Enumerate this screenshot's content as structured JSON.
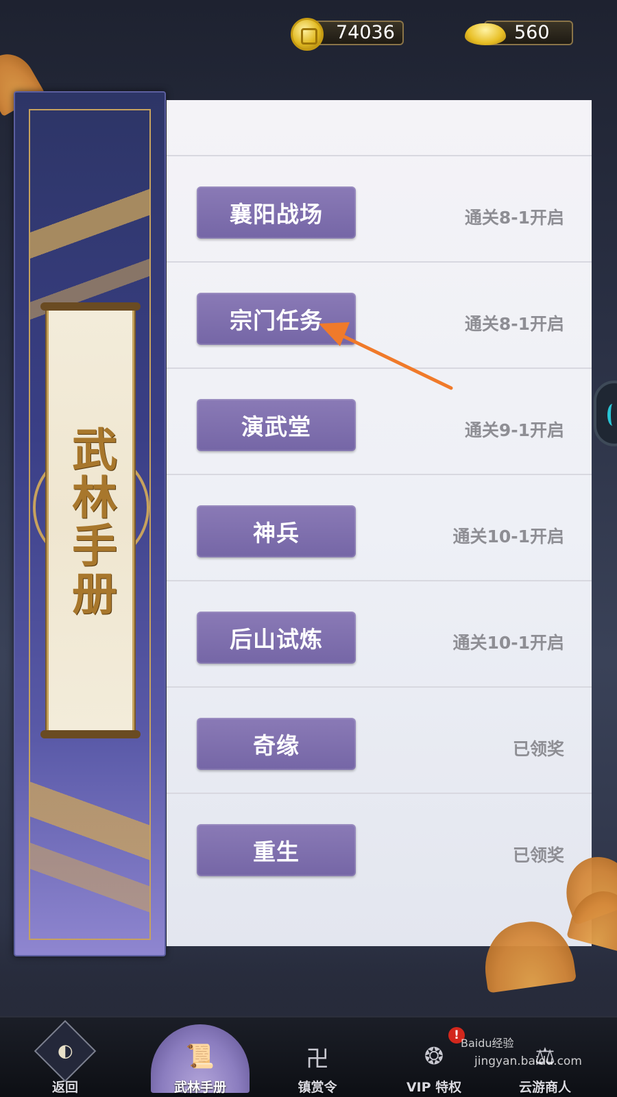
{
  "currency": {
    "coins": "74036",
    "ingots": "560"
  },
  "banner": {
    "title": "武林手册"
  },
  "features": [
    {
      "label": "襄阳战场",
      "status": "通关8-1开启"
    },
    {
      "label": "宗门任务",
      "status": "通关8-1开启"
    },
    {
      "label": "演武堂",
      "status": "通关9-1开启"
    },
    {
      "label": "神兵",
      "status": "通关10-1开启"
    },
    {
      "label": "后山试炼",
      "status": "通关10-1开启"
    },
    {
      "label": "奇缘",
      "status": "已领奖"
    },
    {
      "label": "重生",
      "status": "已领奖"
    }
  ],
  "annotation": {
    "color": "#f07a2a",
    "target": "宗门任务"
  },
  "bottom_nav": {
    "back": "返回",
    "manual": "武林手册",
    "bounty": "镇赏令",
    "vip": "VIP 特权",
    "vip_badge": "!",
    "merchant": "云游商人"
  },
  "watermark": {
    "brand": "Baidu经验",
    "url": "jingyan.baidu.com"
  },
  "colors": {
    "button": "#7f70ae",
    "banner": "#3a3f86",
    "gold": "#c7a25e"
  }
}
